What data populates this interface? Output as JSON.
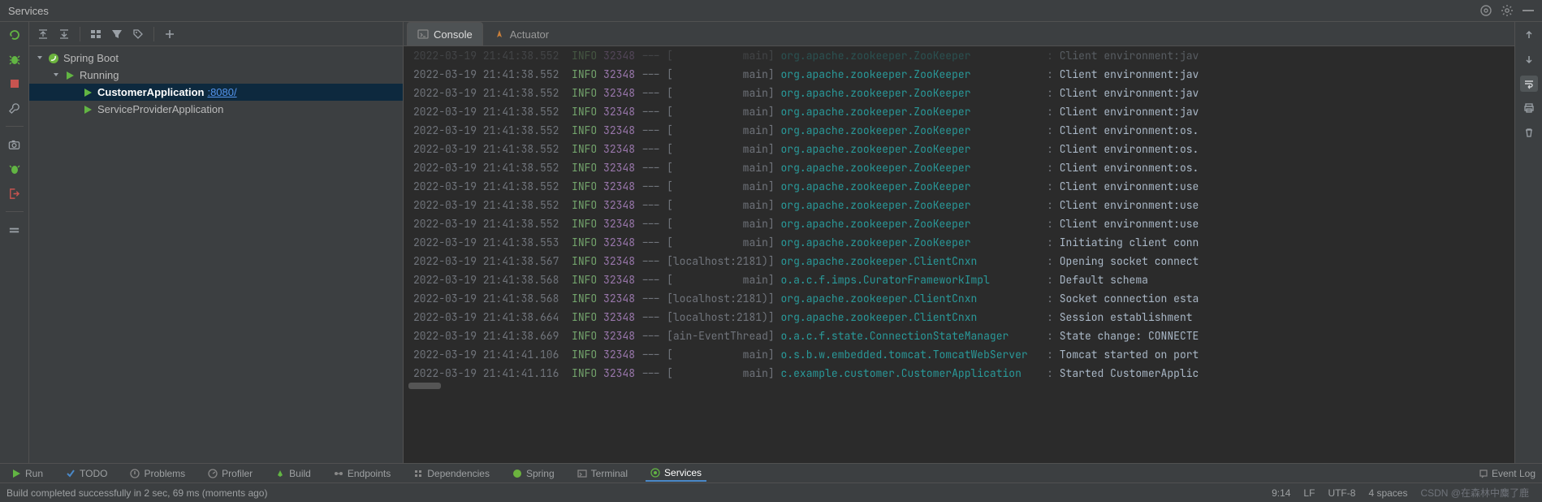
{
  "header": {
    "title": "Services"
  },
  "toolbar": {
    "tree_root": "Spring Boot",
    "running_label": "Running",
    "app1": {
      "name": "CustomerApplication",
      "port": ":8080/"
    },
    "app2": {
      "name": "ServiceProviderApplication"
    }
  },
  "tabs": {
    "console": "Console",
    "actuator": "Actuator"
  },
  "logs": [
    {
      "ts": "2022-03-19 21:41:38.552",
      "lvl": "INFO",
      "pid": "32348",
      "thr": "           main",
      "cls": "org.apache.zookeeper.ZooKeeper           ",
      "msg": "Client environment:jav"
    },
    {
      "ts": "2022-03-19 21:41:38.552",
      "lvl": "INFO",
      "pid": "32348",
      "thr": "           main",
      "cls": "org.apache.zookeeper.ZooKeeper           ",
      "msg": "Client environment:jav"
    },
    {
      "ts": "2022-03-19 21:41:38.552",
      "lvl": "INFO",
      "pid": "32348",
      "thr": "           main",
      "cls": "org.apache.zookeeper.ZooKeeper           ",
      "msg": "Client environment:jav"
    },
    {
      "ts": "2022-03-19 21:41:38.552",
      "lvl": "INFO",
      "pid": "32348",
      "thr": "           main",
      "cls": "org.apache.zookeeper.ZooKeeper           ",
      "msg": "Client environment:os."
    },
    {
      "ts": "2022-03-19 21:41:38.552",
      "lvl": "INFO",
      "pid": "32348",
      "thr": "           main",
      "cls": "org.apache.zookeeper.ZooKeeper           ",
      "msg": "Client environment:os."
    },
    {
      "ts": "2022-03-19 21:41:38.552",
      "lvl": "INFO",
      "pid": "32348",
      "thr": "           main",
      "cls": "org.apache.zookeeper.ZooKeeper           ",
      "msg": "Client environment:os."
    },
    {
      "ts": "2022-03-19 21:41:38.552",
      "lvl": "INFO",
      "pid": "32348",
      "thr": "           main",
      "cls": "org.apache.zookeeper.ZooKeeper           ",
      "msg": "Client environment:use"
    },
    {
      "ts": "2022-03-19 21:41:38.552",
      "lvl": "INFO",
      "pid": "32348",
      "thr": "           main",
      "cls": "org.apache.zookeeper.ZooKeeper           ",
      "msg": "Client environment:use"
    },
    {
      "ts": "2022-03-19 21:41:38.552",
      "lvl": "INFO",
      "pid": "32348",
      "thr": "           main",
      "cls": "org.apache.zookeeper.ZooKeeper           ",
      "msg": "Client environment:use"
    },
    {
      "ts": "2022-03-19 21:41:38.553",
      "lvl": "INFO",
      "pid": "32348",
      "thr": "           main",
      "cls": "org.apache.zookeeper.ZooKeeper           ",
      "msg": "Initiating client conn"
    },
    {
      "ts": "2022-03-19 21:41:38.567",
      "lvl": "INFO",
      "pid": "32348",
      "thr": "localhost:2181)",
      "cls": "org.apache.zookeeper.ClientCnxn          ",
      "msg": "Opening socket connect"
    },
    {
      "ts": "2022-03-19 21:41:38.568",
      "lvl": "INFO",
      "pid": "32348",
      "thr": "           main",
      "cls": "o.a.c.f.imps.CuratorFrameworkImpl        ",
      "msg": "Default schema"
    },
    {
      "ts": "2022-03-19 21:41:38.568",
      "lvl": "INFO",
      "pid": "32348",
      "thr": "localhost:2181)",
      "cls": "org.apache.zookeeper.ClientCnxn          ",
      "msg": "Socket connection esta"
    },
    {
      "ts": "2022-03-19 21:41:38.664",
      "lvl": "INFO",
      "pid": "32348",
      "thr": "localhost:2181)",
      "cls": "org.apache.zookeeper.ClientCnxn          ",
      "msg": "Session establishment "
    },
    {
      "ts": "2022-03-19 21:41:38.669",
      "lvl": "INFO",
      "pid": "32348",
      "thr": "ain-EventThread",
      "cls": "o.a.c.f.state.ConnectionStateManager     ",
      "msg": "State change: CONNECTE"
    },
    {
      "ts": "2022-03-19 21:41:41.106",
      "lvl": "INFO",
      "pid": "32348",
      "thr": "           main",
      "cls": "o.s.b.w.embedded.tomcat.TomcatWebServer  ",
      "msg": "Tomcat started on port"
    },
    {
      "ts": "2022-03-19 21:41:41.116",
      "lvl": "INFO",
      "pid": "32348",
      "thr": "           main",
      "cls": "c.example.customer.CustomerApplication   ",
      "msg": "Started CustomerApplic"
    }
  ],
  "toolwindows": {
    "run": "Run",
    "todo": "TODO",
    "problems": "Problems",
    "profiler": "Profiler",
    "build": "Build",
    "endpoints": "Endpoints",
    "dependencies": "Dependencies",
    "spring": "Spring",
    "terminal": "Terminal",
    "services": "Services",
    "eventlog": "Event Log"
  },
  "status": {
    "build_msg": "Build completed successfully in 2 sec, 69 ms (moments ago)",
    "pos": "9:14",
    "lf": "LF",
    "enc": "UTF-8",
    "indent": "4 spaces",
    "watermark": "CSDN @在森林中麋了鹿"
  }
}
